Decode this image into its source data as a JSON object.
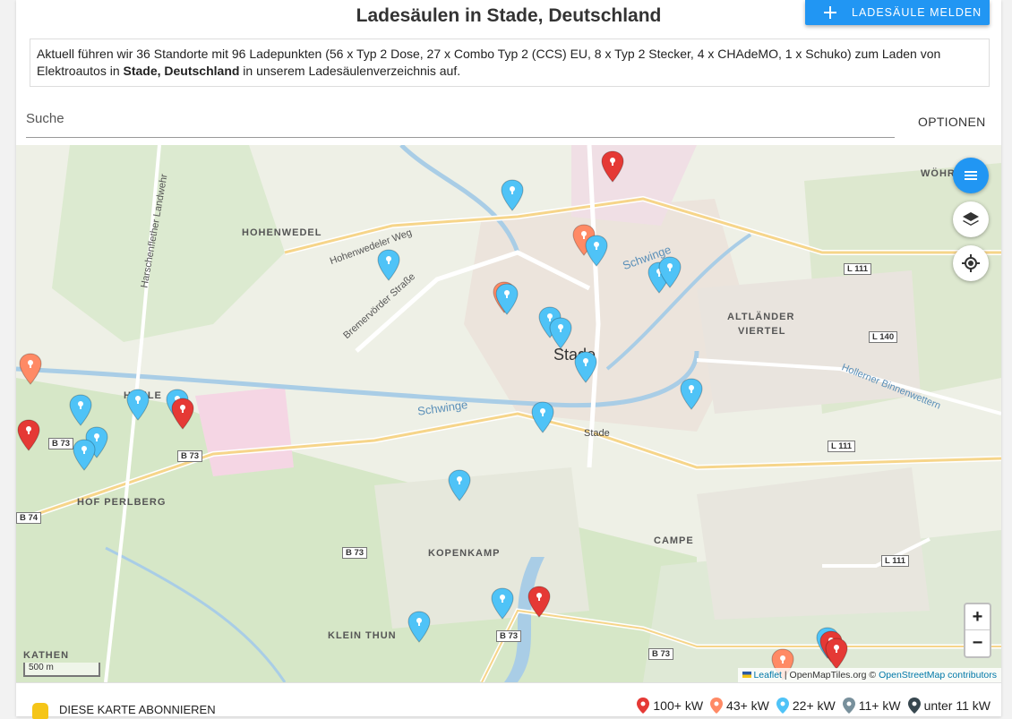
{
  "page": {
    "title": "Ladesäulen in Stade, Deutschland",
    "report_button": "LADESÄULE MELDEN",
    "info_prefix": "Aktuell führen wir 36 Standorte mit 96 Ladepunkten (56 x Typ 2 Dose, 27 x Combo Typ 2 (CCS) EU, 8 x Typ 2 Stecker, 4 x CHAdeMO, 1 x Schuko) zum Laden von Elektroautos in ",
    "info_place": "Stade, Deutschland",
    "info_suffix": " in unserem Ladesäulenverzeichnis auf.",
    "search_placeholder": "Suche",
    "options_label": "OPTIONEN"
  },
  "map": {
    "zoom_in": "+",
    "zoom_out": "−",
    "scale_label": "500 m",
    "attribution_leaflet": "Leaflet",
    "attribution_tiles": " | OpenMapTiles.org © ",
    "attribution_osm": "OpenStreetMap contributors",
    "controls": {
      "list": "list-icon",
      "layers": "layers-icon",
      "locate": "locate-icon",
      "accent": "#2196f3"
    },
    "labels": {
      "hohenwedel": "HOHENWEDEL",
      "stade": "Stade",
      "stade_station": "Stade",
      "altlaender": "ALTLÄNDER",
      "viertel": "VIERTEL",
      "hof_perlberg": "HOF PERLBERG",
      "kopenkamp": "KOPENKAMP",
      "campe": "CAMPE",
      "klein_thun": "KLEIN THUN",
      "kathen": "KATHEN",
      "hahle": "HAHLE",
      "woehr": "WÖHR",
      "schwinge_1": "Schwinge",
      "schwinge_2": "Schwinge",
      "hohenwedeler_weg": "Hohenwedeler Weg",
      "bremervoerder": "Bremervörder Straße",
      "harsefelder": "Harschenflether Landwehr",
      "binnenwettern": "Hollerner Binnenwettern",
      "l111a": "L 111",
      "l140": "L 140",
      "l111b": "L 111",
      "l111c": "L 111",
      "b73a": "B 73",
      "b73b": "B 73",
      "b73c": "B 73",
      "b73d": "B 73",
      "b73e": "B 73",
      "b74": "B 74"
    }
  },
  "markers": [
    {
      "color": "#e53935"
    },
    {
      "color": "#4fc3f7"
    },
    {
      "color": "#ff8a65"
    }
  ],
  "legend": [
    {
      "label": "100+ kW",
      "color": "#e53935"
    },
    {
      "label": "43+ kW",
      "color": "#ff8a65"
    },
    {
      "label": "22+ kW",
      "color": "#4fc3f7"
    },
    {
      "label": "11+ kW",
      "color": "#78909c"
    },
    {
      "label": "unter 11 kW",
      "color": "#37474f"
    }
  ],
  "footer": {
    "subscribe_label": "DIESE KARTE ABONNIEREN"
  }
}
